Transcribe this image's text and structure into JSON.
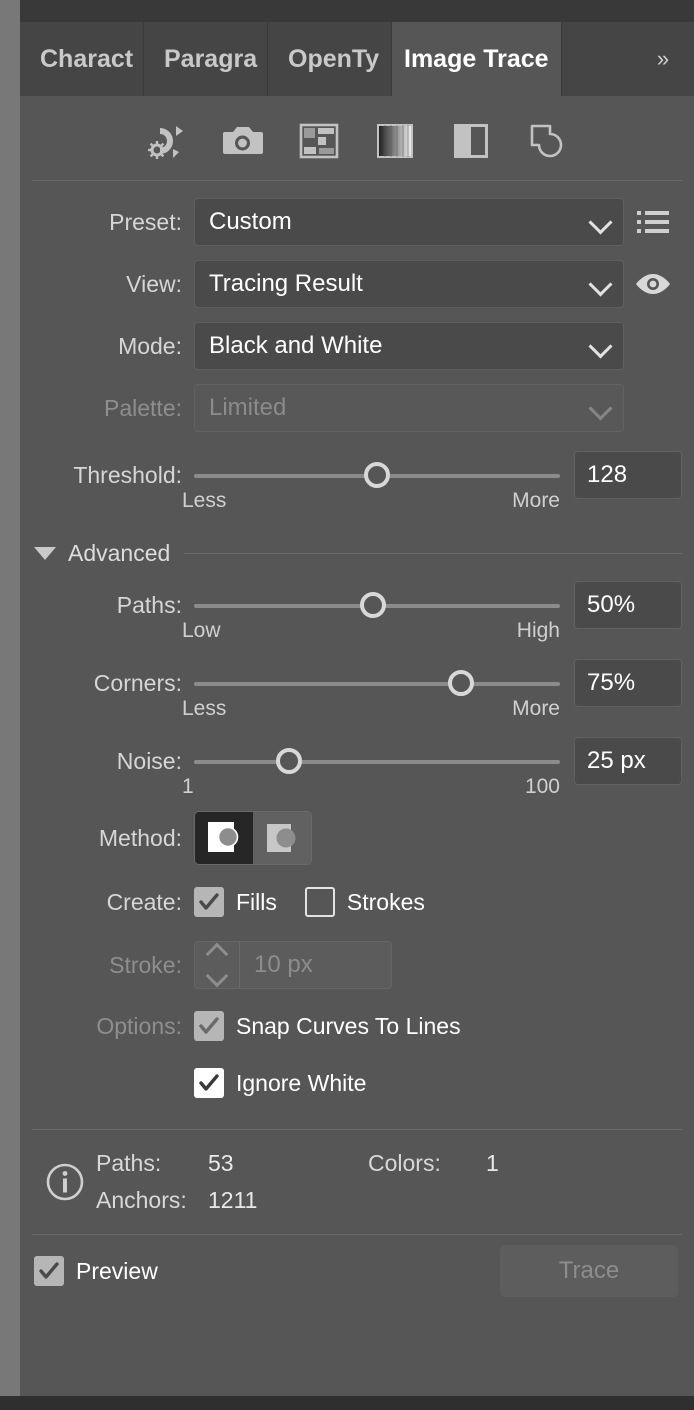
{
  "window": {
    "panel_title": "Image Trace"
  },
  "tabs": [
    {
      "label": "Charact",
      "active": false
    },
    {
      "label": "Paragra",
      "active": false
    },
    {
      "label": "OpenTy",
      "active": false
    },
    {
      "label": "Image Trace",
      "active": true
    }
  ],
  "tab_overflow_label": "»",
  "preset_icons": [
    {
      "name": "auto-color-icon",
      "title": "Auto-Color"
    },
    {
      "name": "high-color-icon",
      "title": "High Color"
    },
    {
      "name": "low-color-icon",
      "title": "Low Color"
    },
    {
      "name": "grayscale-icon",
      "title": "Grayscale"
    },
    {
      "name": "black-and-white-icon",
      "title": "Black and White"
    },
    {
      "name": "outline-icon",
      "title": "Outline"
    }
  ],
  "fields": {
    "preset": {
      "label": "Preset:",
      "value": "Custom",
      "disabled": false
    },
    "view": {
      "label": "View:",
      "value": "Tracing Result",
      "disabled": false
    },
    "mode": {
      "label": "Mode:",
      "value": "Black and White",
      "disabled": false
    },
    "palette": {
      "label": "Palette:",
      "value": "Limited",
      "disabled": true
    }
  },
  "threshold": {
    "label": "Threshold:",
    "value": "128",
    "percent": 50,
    "min_label": "Less",
    "max_label": "More"
  },
  "advanced": {
    "label": "Advanced",
    "expanded": true,
    "paths": {
      "label": "Paths:",
      "value": "50%",
      "percent": 49,
      "min_label": "Low",
      "max_label": "High"
    },
    "corners": {
      "label": "Corners:",
      "value": "75%",
      "percent": 73,
      "min_label": "Less",
      "max_label": "More"
    },
    "noise": {
      "label": "Noise:",
      "value": "25 px",
      "percent": 26,
      "min_label": "1",
      "max_label": "100"
    },
    "method": {
      "label": "Method:",
      "options": [
        {
          "name": "abutting",
          "selected": true
        },
        {
          "name": "overlapping",
          "selected": false
        }
      ]
    },
    "create": {
      "label": "Create:",
      "fills": {
        "label": "Fills",
        "checked": true,
        "disabled": false
      },
      "strokes": {
        "label": "Strokes",
        "checked": false,
        "disabled": false
      }
    },
    "stroke": {
      "label": "Stroke:",
      "value": "10 px",
      "disabled": true
    },
    "options": {
      "label": "Options:",
      "snap_curves": {
        "label": "Snap Curves To Lines",
        "checked": true,
        "disabled": true
      },
      "ignore_white": {
        "label": "Ignore White",
        "checked": true,
        "disabled": false
      }
    }
  },
  "info": {
    "paths_label": "Paths:",
    "paths_value": "53",
    "colors_label": "Colors:",
    "colors_value": "1",
    "anchors_label": "Anchors:",
    "anchors_value": "1211"
  },
  "footer": {
    "preview_label": "Preview",
    "preview_checked": true,
    "trace_label": "Trace",
    "trace_disabled": true
  },
  "colors": {
    "panel_bg": "#565656",
    "tabbar_bg": "#3b3b3b",
    "tab_bg": "#454545",
    "tab_active_bg": "#565656",
    "field_bg": "#4a4a4a",
    "text": "#ffffff",
    "label": "#d6d6d6",
    "disabled_text": "#8b8b8b",
    "track": "#8b8b8b",
    "knob": "#d8d8d8"
  }
}
